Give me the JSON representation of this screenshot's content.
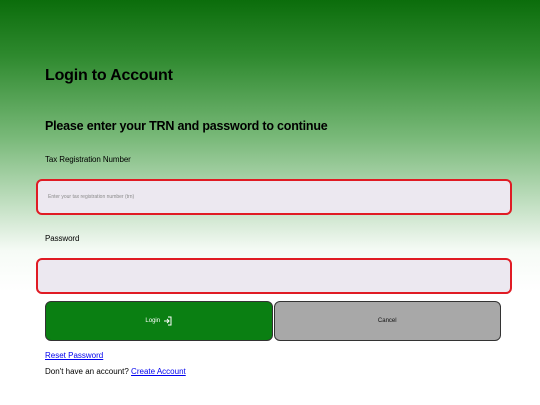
{
  "header": {
    "title": "Login to Account",
    "subtitle": "Please enter your TRN and password to continue"
  },
  "form": {
    "trn_label": "Tax Registration Number",
    "trn_placeholder": "Enter your tax registration number (trn)",
    "trn_value": "",
    "password_label": "Password",
    "password_placeholder": "",
    "password_value": ""
  },
  "buttons": {
    "login_label": "Login",
    "login_icon": "login-icon",
    "cancel_label": "Cancel"
  },
  "links": {
    "reset_password": "Reset Password",
    "no_account_text": "Don't have an account?",
    "create_account": "Create Account"
  },
  "colors": {
    "gradient_top": "#0b6d0b",
    "login_button": "#0a7f12",
    "cancel_button": "#a8a8a8",
    "input_border": "#e01b24",
    "input_background": "#ece8f0",
    "link": "#0000ee"
  }
}
